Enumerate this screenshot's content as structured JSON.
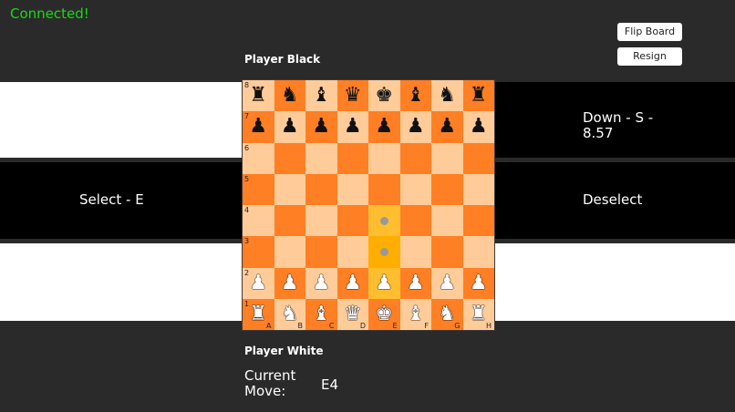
{
  "status": "Connected!",
  "buttons": {
    "flip": "Flip Board",
    "resign": "Resign"
  },
  "players": {
    "top": "Player Black",
    "bottom": "Player White"
  },
  "controls": {
    "right_top": "Down - S - 8.57",
    "left_mid": "Select - E",
    "right_mid": "Deselect"
  },
  "current_move": {
    "label": "Current Move:",
    "value": "E4"
  },
  "board": {
    "files": [
      "A",
      "B",
      "C",
      "D",
      "E",
      "F",
      "G",
      "H"
    ],
    "ranks": [
      "8",
      "7",
      "6",
      "5",
      "4",
      "3",
      "2",
      "1"
    ],
    "rows": [
      [
        "bR",
        "bN",
        "bB",
        "bQ",
        "bK",
        "bB",
        "bN",
        "bR"
      ],
      [
        "bP",
        "bP",
        "bP",
        "bP",
        "bP",
        "bP",
        "bP",
        "bP"
      ],
      [
        "",
        "",
        "",
        "",
        "",
        "",
        "",
        ""
      ],
      [
        "",
        "",
        "",
        "",
        "",
        "",
        "",
        ""
      ],
      [
        "",
        "",
        "",
        "",
        "",
        "",
        "",
        ""
      ],
      [
        "",
        "",
        "",
        "",
        "",
        "",
        "",
        ""
      ],
      [
        "wP",
        "wP",
        "wP",
        "wP",
        "wP",
        "wP",
        "wP",
        "wP"
      ],
      [
        "wR",
        "wN",
        "wB",
        "wQ",
        "wK",
        "wB",
        "wN",
        "wR"
      ]
    ],
    "selected_square": "E2",
    "move_hints": [
      "E4",
      "E3"
    ]
  },
  "colors": {
    "light": "#ffcc99",
    "dark": "#ff7f24",
    "highlight": "#ffae00",
    "status": "#14dc14"
  }
}
